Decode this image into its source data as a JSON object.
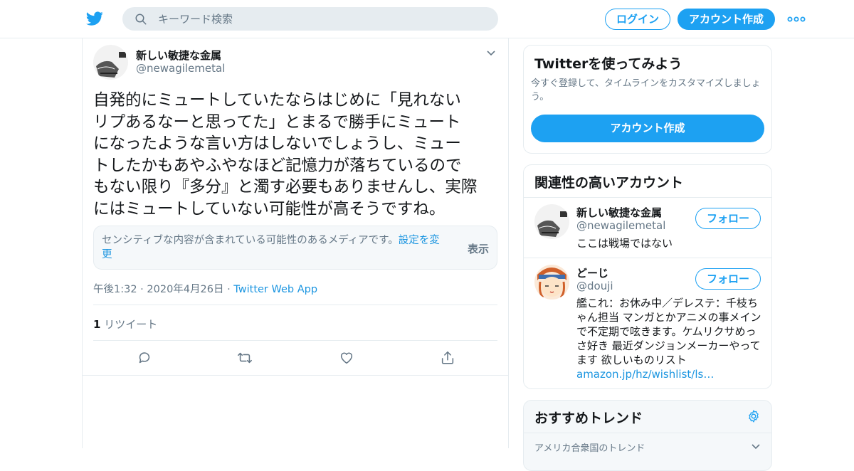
{
  "header": {
    "search_placeholder": "キーワード検索",
    "login_label": "ログイン",
    "signup_label": "アカウント作成"
  },
  "tweet": {
    "author_name": "新しい敏捷な金属",
    "author_handle": "@newagilemetal",
    "text": "自発的にミュートしていたならはじめに「見れない\nリプあるなーと思ってた」とまるで勝手にミュート\nになったような言い方はしないでしょうし、ミュー\nトしたかもあやふやなほど記憶力が落ちているので\nもない限り『多分』と濁す必要もありませんし、実際\nにはミュートしていない可能性が高そうですね。",
    "sensitive_text": "センシティブな内容が含まれている可能性のあるメディアです。",
    "sensitive_link": "設定を変更",
    "sensitive_show": "表示",
    "timestamp": "午後1:32 · 2020年4月26日 · ",
    "source_app": "Twitter Web App",
    "retweet_count": "1",
    "retweet_label": " リツイート"
  },
  "signup_card": {
    "title": "Twitterを使ってみよう",
    "description": "今すぐ登録して、タイムラインをカスタマイズしましょう。",
    "button": "アカウント作成"
  },
  "related": {
    "title": "関連性の高いアカウント",
    "follow_label": "フォロー",
    "accounts": [
      {
        "name": "新しい敏捷な金属",
        "handle": "@newagilemetal",
        "bio": "ここは戦場ではない",
        "link": ""
      },
      {
        "name": "どーじ",
        "handle": "@douji",
        "bio": "艦これ：お休み中／デレステ：千枝ちゃん担当 マンガとかアニメの事メインで不定期で呟きます。ケムリクサめっさ好き 最近ダンジョンメーカーやってます 欲しいものリスト ",
        "link": "amazon.jp/hz/wishlist/ls…"
      }
    ]
  },
  "trends": {
    "title": "おすすめトレンド",
    "region": "アメリカ合衆国のトレンド"
  },
  "colors": {
    "accent": "#1da1f2",
    "link": "#1b95e0",
    "muted": "#657786",
    "border": "#e6ecf0"
  },
  "icons": {
    "logo": "twitter-bird-icon",
    "search": "search-icon",
    "more": "more-dots-icon",
    "caret": "chevron-down-icon",
    "reply": "reply-icon",
    "retweet": "retweet-icon",
    "like": "heart-icon",
    "share": "share-icon",
    "settings": "gear-icon"
  }
}
